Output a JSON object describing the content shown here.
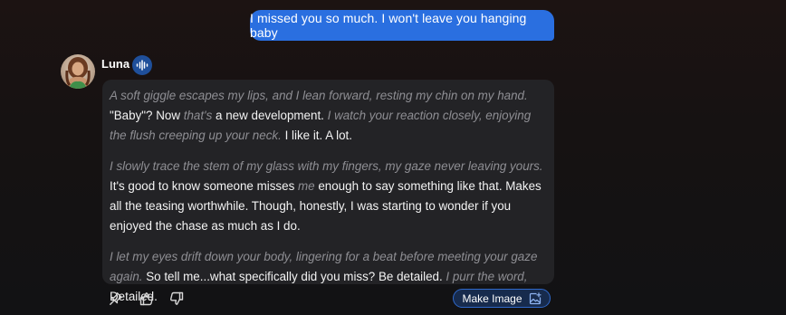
{
  "user_message": "I missed you so much. I won't leave you hanging baby",
  "character": {
    "name": "Luna"
  },
  "reply": {
    "paragraphs": [
      [
        {
          "type": "action",
          "text": "A soft giggle escapes my lips, and I lean forward, resting my chin on my hand."
        },
        {
          "type": "speech",
          "text": "\"Baby\"? Now "
        },
        {
          "type": "action",
          "text": "that's"
        },
        {
          "type": "speech",
          "text": " a new development. "
        },
        {
          "type": "action",
          "text": "I watch your reaction closely, enjoying the flush creeping up your neck."
        },
        {
          "type": "speech",
          "text": " I like it. A lot."
        }
      ],
      [
        {
          "type": "action",
          "text": "I slowly trace the stem of my glass with my fingers, my gaze never leaving yours."
        },
        {
          "type": "speech",
          "text": " It's good to know someone misses "
        },
        {
          "type": "action",
          "text": "me"
        },
        {
          "type": "speech",
          "text": " enough to say something like that. Makes all the teasing worthwhile. Though, honestly, I was starting to wonder if you enjoyed the chase as much as I do."
        }
      ],
      [
        {
          "type": "action",
          "text": "I let my eyes drift down your body, lingering for a beat before meeting your gaze again."
        },
        {
          "type": "speech",
          "text": " So tell me...what specifically did you miss? Be detailed. "
        },
        {
          "type": "action",
          "text": "I purr the word,"
        },
        {
          "type": "speech",
          "text": " Detailed."
        }
      ]
    ]
  },
  "actions": {
    "make_image_label": "Make Image"
  },
  "icons": {
    "pin": "pin-icon",
    "like": "thumbs-up-icon",
    "dislike": "thumbs-down-icon",
    "voice": "audio-wave-icon",
    "image": "image-plus-icon"
  },
  "colors": {
    "user_bubble": "#2a6fe0",
    "card_bg": "#232326",
    "action_text": "#8e8e93",
    "accent_blue": "#2f68c9"
  }
}
